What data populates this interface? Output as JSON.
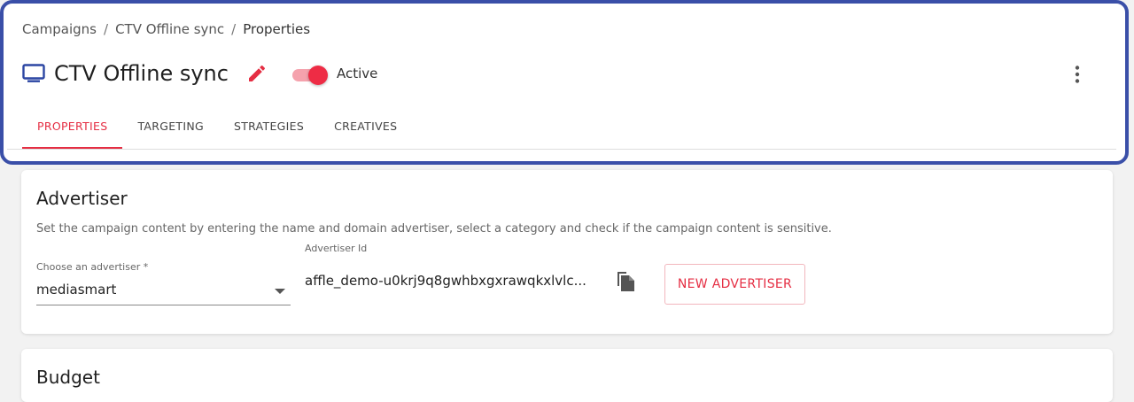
{
  "breadcrumb": {
    "items": [
      "Campaigns",
      "CTV Offline sync",
      "Properties"
    ],
    "separator": "/"
  },
  "header": {
    "title": "CTV Offline sync",
    "title_icon": "tv-icon",
    "status_label": "Active",
    "status_on": true
  },
  "tabs": [
    {
      "label": "PROPERTIES",
      "active": true
    },
    {
      "label": "TARGETING",
      "active": false
    },
    {
      "label": "STRATEGIES",
      "active": false
    },
    {
      "label": "CREATIVES",
      "active": false
    }
  ],
  "advertiser": {
    "title": "Advertiser",
    "description": "Set the campaign content by entering the name and domain advertiser, select a category and check if the campaign content is sensitive.",
    "select_label": "Choose an advertiser *",
    "select_value": "mediasmart",
    "id_label": "Advertiser Id",
    "id_value": "affle_demo-u0krj9q8gwhbxgxrawqkxlvlc...",
    "new_button_label": "NEW ADVERTISER"
  },
  "budget": {
    "title": "Budget"
  },
  "colors": {
    "accent": "#e52e43",
    "primary_icon": "#2c46a3",
    "focus_border": "#3a4fa8",
    "toggle_track": "#f5a2ad"
  }
}
